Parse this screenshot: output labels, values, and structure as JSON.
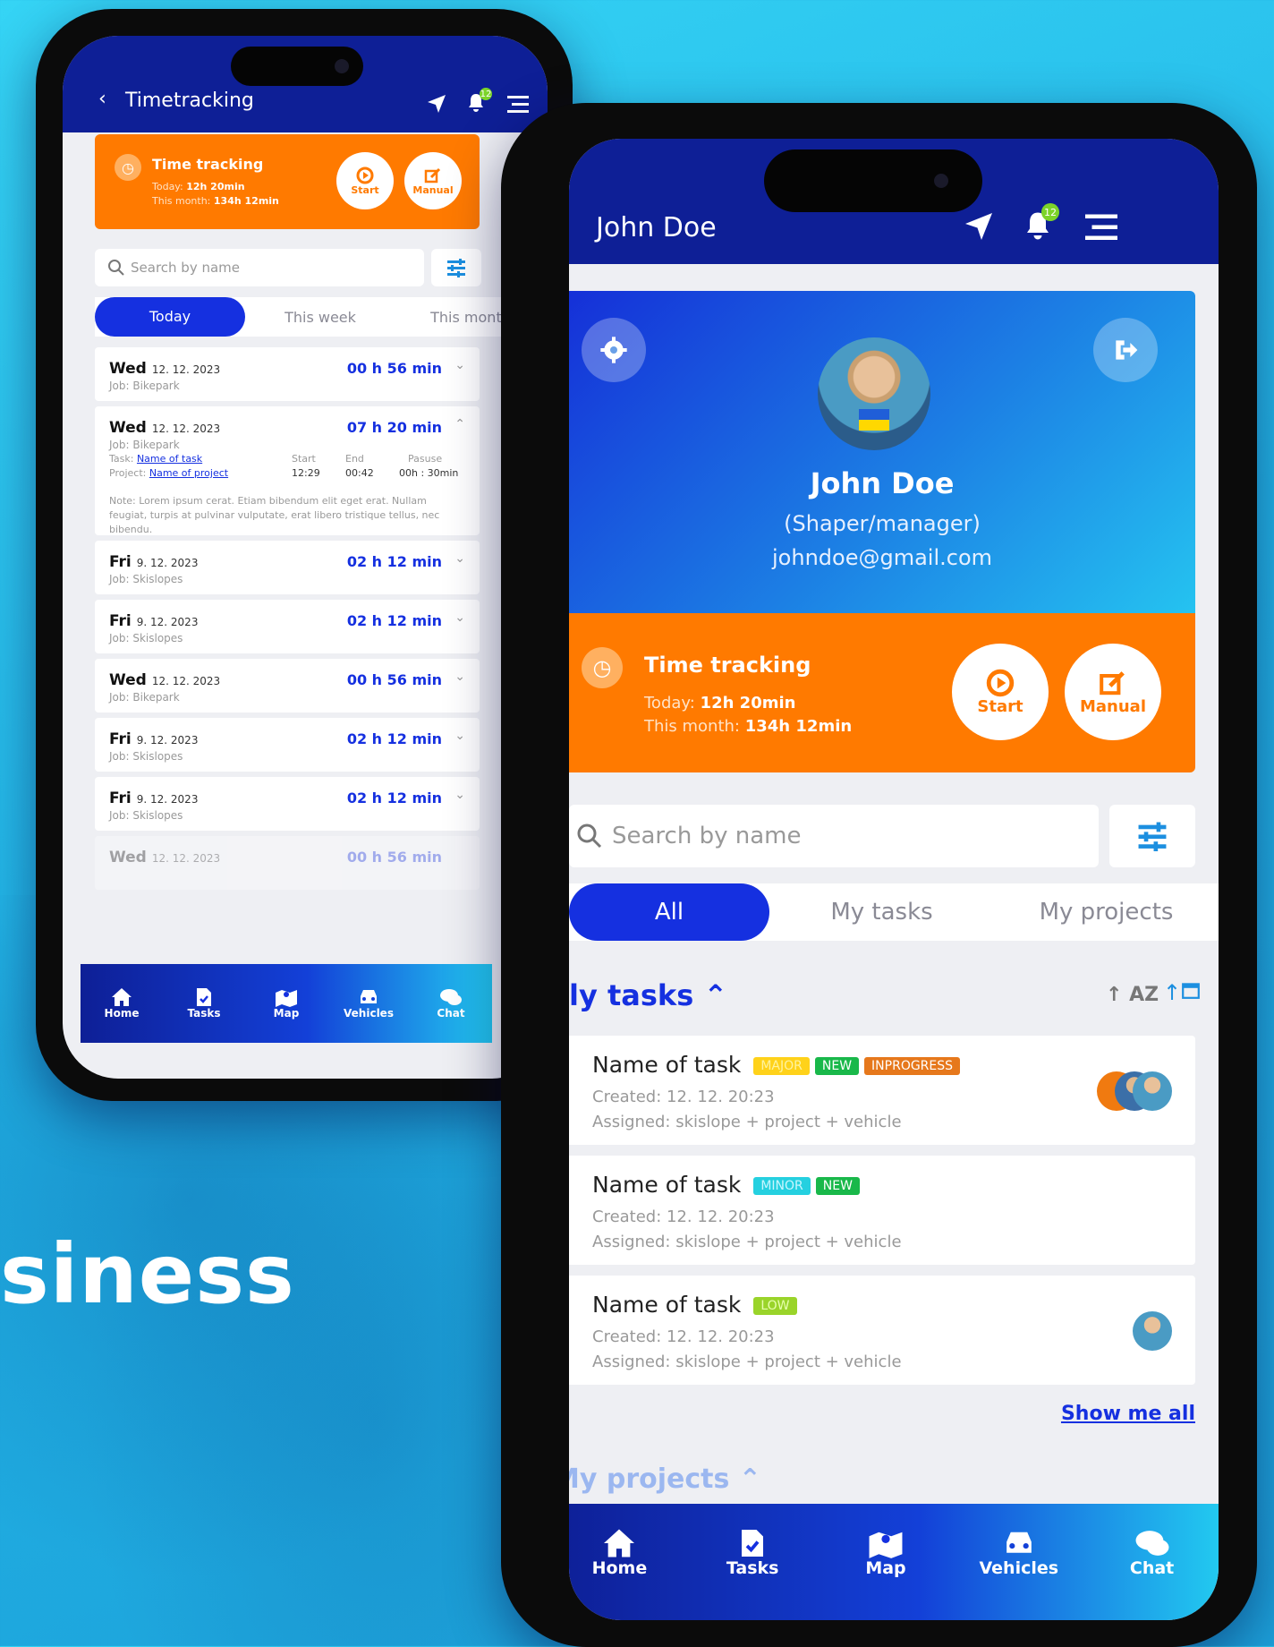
{
  "tagline": "siness",
  "colors": {
    "primary": "#0e1f96",
    "accent_blue": "#1530e0",
    "orange": "#ff7a00",
    "green": "#7cd32a"
  },
  "left_phone": {
    "header": {
      "back_icon": "chevron-left-icon",
      "title": "Timetracking",
      "notif_count": "12"
    },
    "time_tracking": {
      "title": "Time tracking",
      "today_label": "Today:",
      "today_value": "12h 20min",
      "month_label": "This month:",
      "month_value": "134h 12min",
      "start_label": "Start",
      "manual_label": "Manual"
    },
    "search": {
      "placeholder": "Search by name"
    },
    "tabs": [
      "Today",
      "This week",
      "This month"
    ],
    "entries": [
      {
        "day": "Wed",
        "date": "12. 12. 2023",
        "job": "Job: Bikepark",
        "duration": "00 h 56 min"
      },
      {
        "day": "Wed",
        "date": "12. 12. 2023",
        "job": "Job: Bikepark",
        "duration": "07 h 20 min",
        "task_label": "Task:",
        "task_link": "Name of task",
        "project_label": "Project:",
        "project_link": "Name of project",
        "start_label": "Start",
        "start_value": "12:29",
        "end_label": "End",
        "end_value": "00:42",
        "pause_label": "Pasuse",
        "pause_value": "00h : 30min",
        "note": "Note: Lorem ipsum cerat. Etiam bibendum elit eget erat. Nullam feugiat, turpis at pulvinar vulputate, erat libero tristique tellus, nec bibendu."
      },
      {
        "day": "Fri",
        "date": "9. 12. 2023",
        "job": "Job: Skislopes",
        "duration": "02 h 12 min"
      },
      {
        "day": "Fri",
        "date": "9. 12. 2023",
        "job": "Job: Skislopes",
        "duration": "02 h 12 min"
      },
      {
        "day": "Wed",
        "date": "12. 12. 2023",
        "job": "Job: Bikepark",
        "duration": "00 h 56 min"
      },
      {
        "day": "Fri",
        "date": "9. 12. 2023",
        "job": "Job: Skislopes",
        "duration": "02 h 12 min"
      },
      {
        "day": "Fri",
        "date": "9. 12. 2023",
        "job": "Job: Skislopes",
        "duration": "02 h 12 min"
      },
      {
        "day": "Wed",
        "date": "12. 12. 2023",
        "job": "",
        "duration": "00 h 56 min"
      }
    ],
    "nav": [
      "Home",
      "Tasks",
      "Map",
      "Vehicles",
      "Chat"
    ]
  },
  "right_phone": {
    "header": {
      "title": "John Doe",
      "notif_count": "12"
    },
    "profile": {
      "name": "John Doe",
      "role": "(Shaper/manager)",
      "email": "johndoe@gmail.com"
    },
    "time_tracking": {
      "title": "Time tracking",
      "today_label": "Today:",
      "today_value": "12h 20min",
      "month_label": "This month:",
      "month_value": "134h 12min",
      "start_label": "Start",
      "manual_label": "Manual"
    },
    "search": {
      "placeholder": "Search by name"
    },
    "tabs": [
      "All",
      "My tasks",
      "My projects"
    ],
    "my_tasks_title": "ly tasks",
    "sort_az": "AZ",
    "tasks": [
      {
        "name": "Name of task",
        "tags": [
          {
            "t": "MAJOR",
            "c": "#ffd21a"
          },
          {
            "t": "NEW",
            "c": "#19b84a"
          },
          {
            "t": "INPROGRESS",
            "c": "#e6781c"
          }
        ],
        "created": "Created: 12. 12. 20:23",
        "assigned": "Assigned: skislope + project + vehicle"
      },
      {
        "name": "Name of task",
        "tags": [
          {
            "t": "MINOR",
            "c": "#25d0e0"
          },
          {
            "t": "NEW",
            "c": "#19b84a"
          }
        ],
        "created": "Created: 12. 12. 20:23",
        "assigned": "Assigned: skislope + project + vehicle"
      },
      {
        "name": "Name of task",
        "tags": [
          {
            "t": "LOW",
            "c": "#9ad42a"
          }
        ],
        "created": "Created: 12. 12. 20:23",
        "assigned": "Assigned: skislope + project + vehicle"
      }
    ],
    "show_all": "Show me all",
    "my_projects_title": "My projects",
    "nav": [
      "Home",
      "Tasks",
      "Map",
      "Vehicles",
      "Chat"
    ]
  }
}
